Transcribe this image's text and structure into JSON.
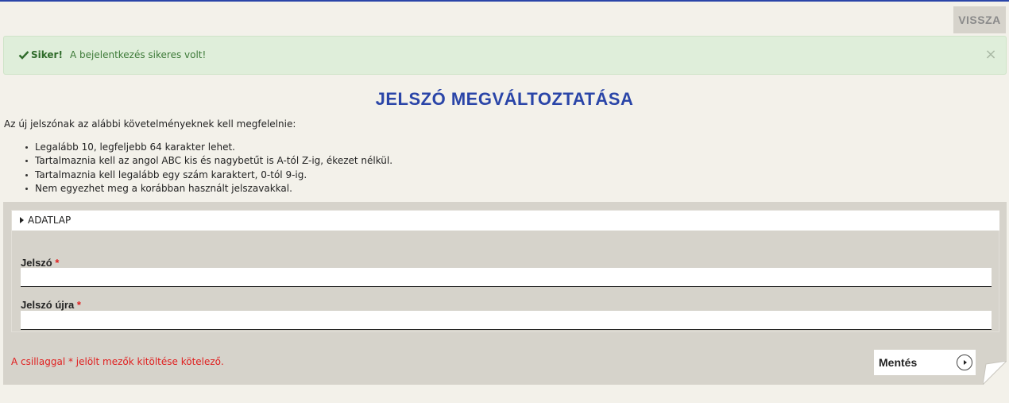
{
  "header": {
    "back_label": "VISSZA"
  },
  "alert": {
    "title": "Siker!",
    "message": "A bejelentkezés sikeres volt!",
    "close": "×",
    "icon": "check-icon"
  },
  "page": {
    "title": "JELSZÓ MEGVÁLTOZTATÁSA",
    "intro": "Az új jelszónak az alábbi követelményeknek kell megfelelnie:",
    "requirements": [
      "Legalább 10, legfeljebb 64 karakter lehet.",
      "Tartalmaznia kell az angol ABC kis és nagybetűt is A-tól Z-ig, ékezet nélkül.",
      "Tartalmaznia kell legalább egy szám karaktert, 0-tól 9-ig.",
      "Nem egyezhet meg a korábban használt jelszavakkal."
    ]
  },
  "form": {
    "section_label": "ADATLAP",
    "fields": [
      {
        "label": "Jelszó",
        "required_mark": "*",
        "value": ""
      },
      {
        "label": "Jelszó újra",
        "required_mark": "*",
        "value": ""
      }
    ],
    "required_note": "A csillaggal * jelölt mezők kitöltése kötelező.",
    "save_label": "Mentés"
  },
  "colors": {
    "accent": "#2a45a8",
    "alert_bg": "#dfeeda",
    "alert_text": "#3d7a38",
    "required": "#e02020",
    "panel": "#d6d3cb",
    "page_bg": "#f3f1ea"
  }
}
